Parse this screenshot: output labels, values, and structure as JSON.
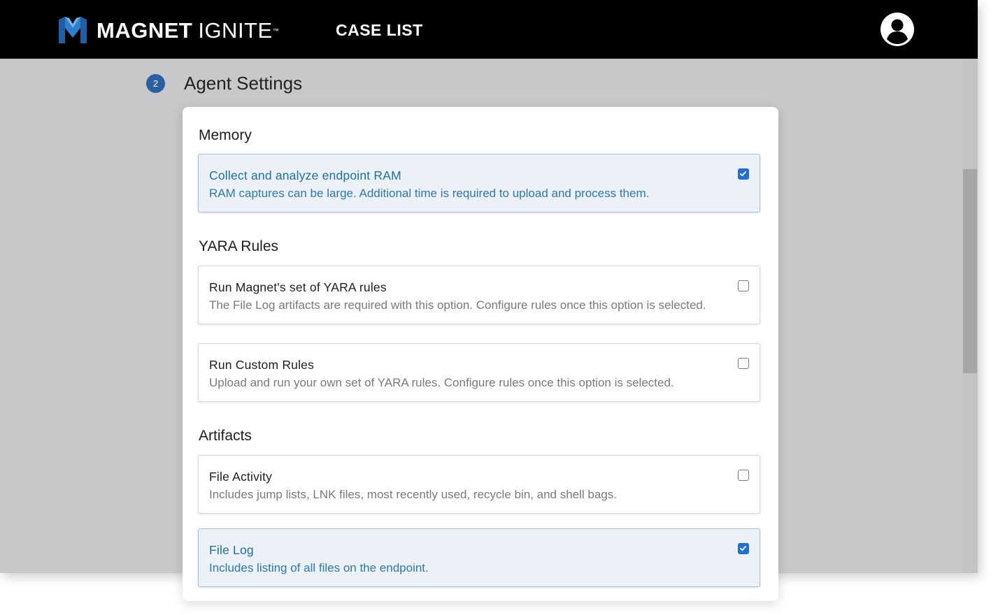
{
  "header": {
    "brand_bold": "MAGNET",
    "brand_light": "IGNITE",
    "trademark": "™",
    "nav_case_list": "CASE LIST"
  },
  "step": {
    "number": "2",
    "title": "Agent Settings"
  },
  "sections": {
    "memory": {
      "title": "Memory",
      "options": [
        {
          "title": "Collect and analyze endpoint RAM",
          "description": "RAM captures can be large. Additional time is required to upload and process them.",
          "checked": true
        }
      ]
    },
    "yara": {
      "title": "YARA Rules",
      "options": [
        {
          "title": "Run Magnet's set of YARA rules",
          "description": "The File Log artifacts are required with this option. Configure rules once this option is selected.",
          "checked": false
        },
        {
          "title": "Run Custom Rules",
          "description": "Upload and run your own set of YARA rules. Configure rules once this option is selected.",
          "checked": false
        }
      ]
    },
    "artifacts": {
      "title": "Artifacts",
      "options": [
        {
          "title": "File Activity",
          "description": "Includes jump lists, LNK files, most recently used, recycle bin, and shell bags.",
          "checked": false
        },
        {
          "title": "File Log",
          "description": "Includes listing of all files on the endpoint.",
          "checked": true
        }
      ]
    }
  },
  "colors": {
    "topbar": "#000000",
    "accent": "#1f6fd6",
    "selected_text": "#1d6fa8",
    "step_badge": "#2a5fa4"
  }
}
